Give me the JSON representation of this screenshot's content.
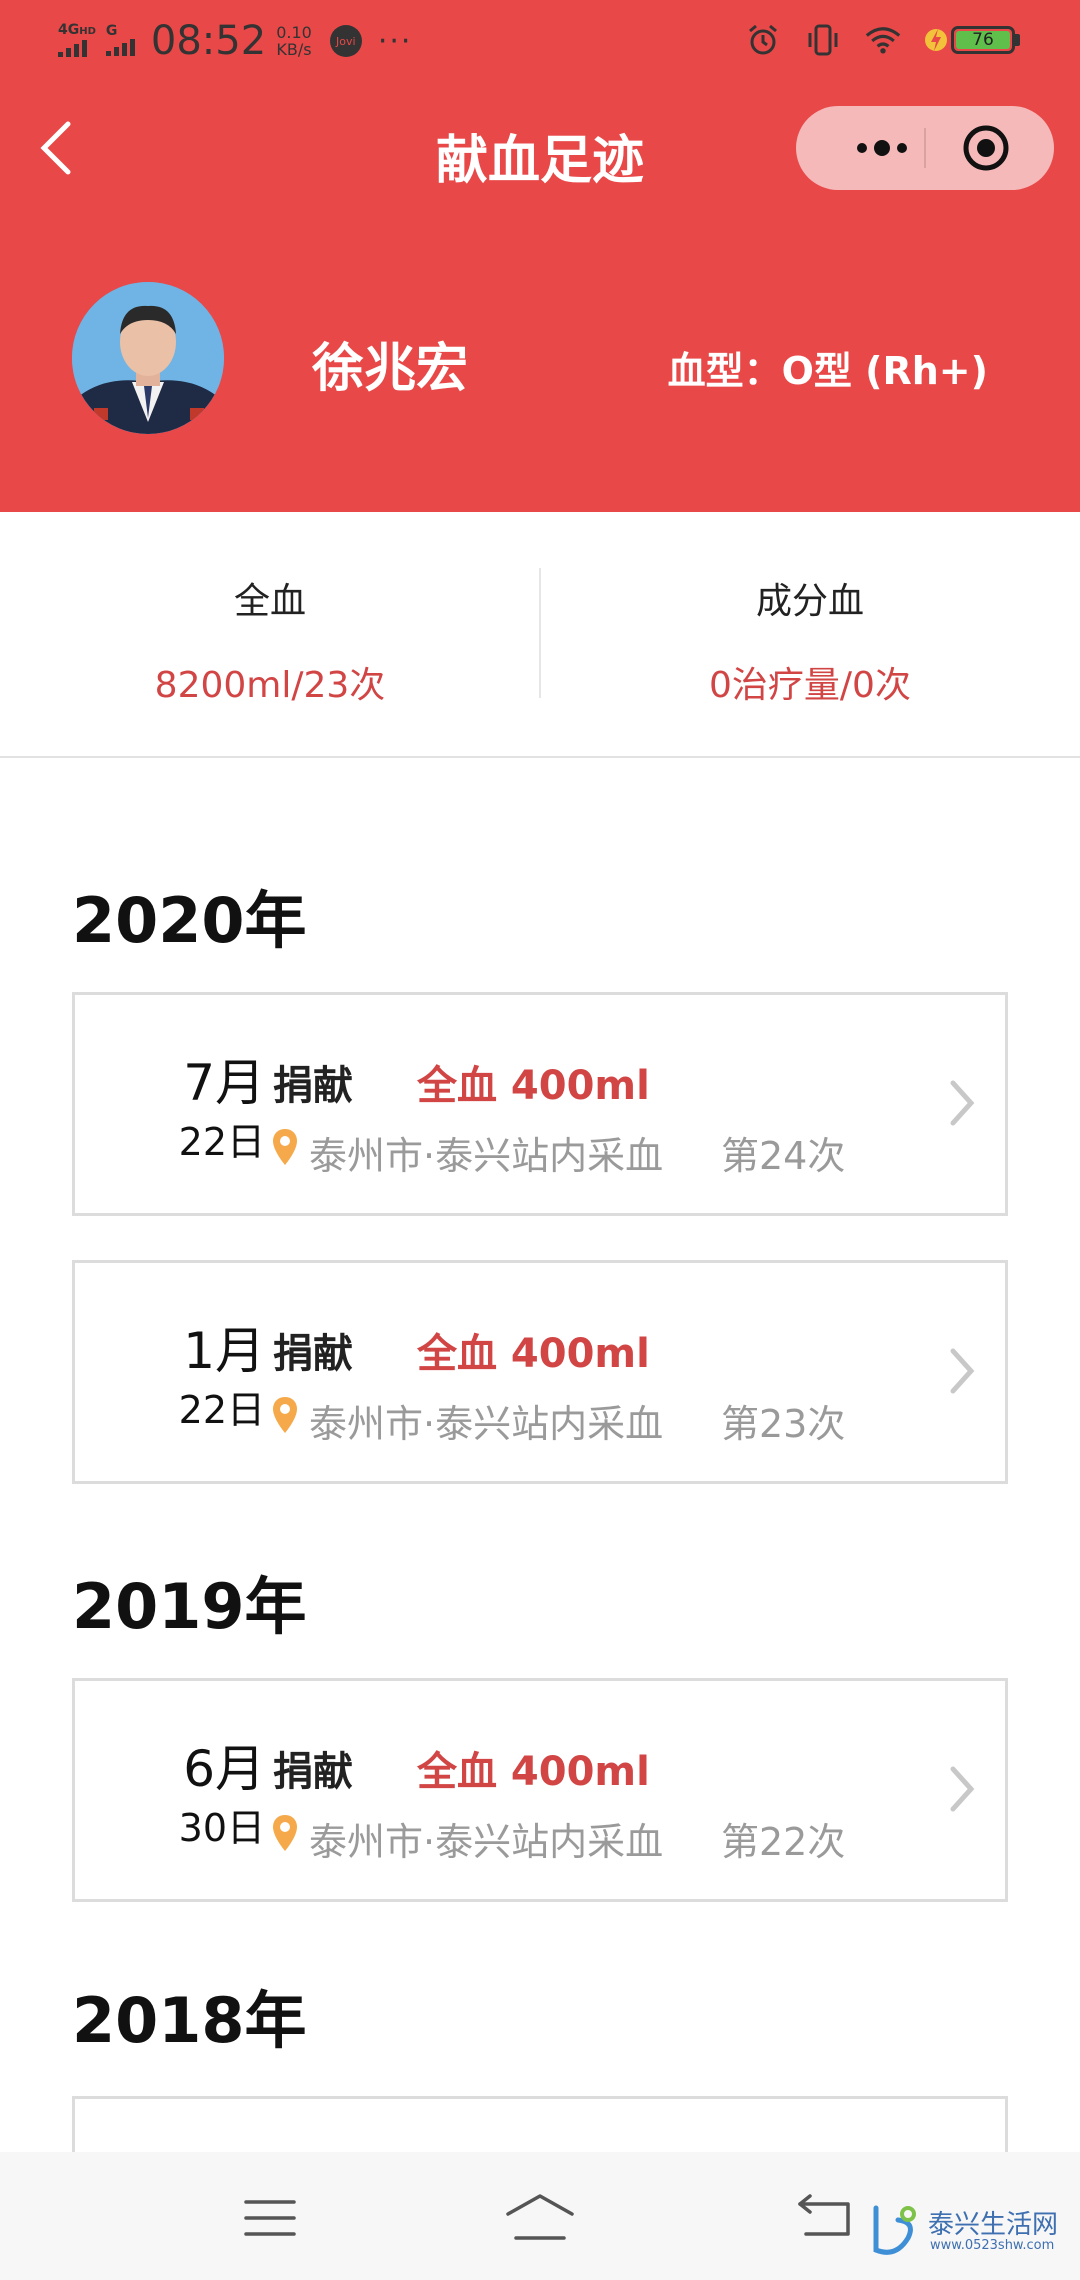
{
  "status_bar": {
    "network": "4G",
    "network_hd": "HD",
    "network2": "G",
    "time": "08:52",
    "speed_value": "0.10",
    "speed_unit": "KB/s",
    "jovi": "Jovi",
    "more": "···",
    "battery": "76"
  },
  "navbar": {
    "title": "献血足迹"
  },
  "profile": {
    "name": "徐兆宏",
    "blood_type": "血型：O型 (Rh+)"
  },
  "stats": {
    "whole_blood_label": "全血",
    "whole_blood_value": "8200ml/23次",
    "component_label": "成分血",
    "component_value": "0治疗量/0次"
  },
  "years": [
    {
      "year": "2020年",
      "records": [
        {
          "month": "7月",
          "day": "22日",
          "type": "捐献",
          "amount": "全血 400ml",
          "location": "泰州市·泰兴站内采血",
          "count": "第24次"
        },
        {
          "month": "1月",
          "day": "22日",
          "type": "捐献",
          "amount": "全血 400ml",
          "location": "泰州市·泰兴站内采血",
          "count": "第23次"
        }
      ]
    },
    {
      "year": "2019年",
      "records": [
        {
          "month": "6月",
          "day": "30日",
          "type": "捐献",
          "amount": "全血 400ml",
          "location": "泰州市·泰兴站内采血",
          "count": "第22次"
        }
      ]
    },
    {
      "year": "2018年",
      "records": []
    }
  ],
  "watermark": {
    "text": "泰兴生活网",
    "url": "www.0523shw.com"
  },
  "colors": {
    "header_red": "#e84848",
    "accent_red": "#d24545",
    "pin_orange": "#f5a94a",
    "muted_gray": "#9a9a9a"
  }
}
